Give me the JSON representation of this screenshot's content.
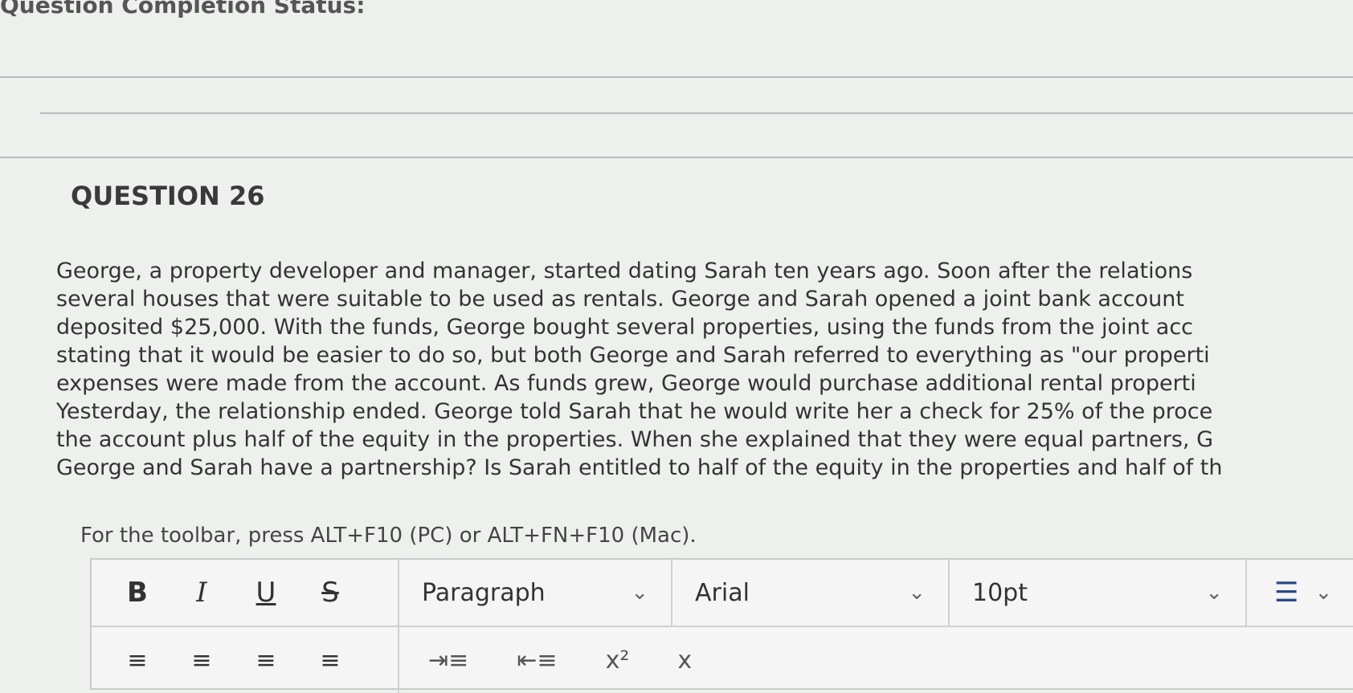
{
  "header": {
    "status_title": "Question Completion Status:"
  },
  "question": {
    "title": "QUESTION 26",
    "body_lines": [
      "George, a property developer and manager, started dating Sarah ten years ago. Soon after the relations",
      "several houses that were suitable to be used as rentals. George and Sarah opened a joint bank account",
      "deposited $25,000. With the funds, George bought several properties, using the funds from the joint acc",
      "stating that it would be easier to do so, but both George and Sarah referred to everything as \"our properti",
      "expenses were made from the account. As funds grew, George would purchase additional rental properti",
      "Yesterday, the relationship ended. George told Sarah that he would write her a check for 25% of the proce",
      "the account plus half of the equity in the properties. When she explained that they were equal partners, G",
      "George and Sarah have a partnership? Is Sarah entitled to half of the equity in the properties and half of th"
    ]
  },
  "editor": {
    "toolbar_hint": "For the toolbar, press ALT+F10 (PC) or ALT+FN+F10 (Mac).",
    "format_buttons": {
      "bold": "B",
      "italic": "I",
      "underline": "U",
      "strike": "S"
    },
    "paragraph_select": {
      "value": "Paragraph",
      "icon": "chevron-down-icon"
    },
    "font_select": {
      "value": "Arial",
      "icon": "chevron-down-icon"
    },
    "size_select": {
      "value": "10pt",
      "icon": "chevron-down-icon"
    },
    "list": {
      "icon": "bulleted-list-icon",
      "glyph": "☰",
      "chevron": "⌄"
    },
    "row2": {
      "align_left": "≡",
      "align_center": "≡",
      "align_right": "≡",
      "align_justify": "≡",
      "indent": "⇥≡",
      "outdent": "⇤≡",
      "superscript": "x²",
      "subscript": "x"
    }
  }
}
